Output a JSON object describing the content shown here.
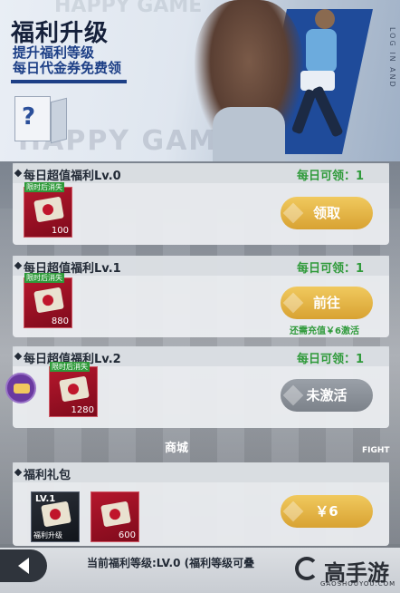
{
  "header": {
    "title": "福利升级",
    "subtitle_line1": "提升福利等级",
    "subtitle_line2": "每日代金券免费领",
    "watermark": "HAPPY GAME",
    "side_text": "LOG IN AND"
  },
  "tiers": [
    {
      "title": "每日超值福利Lv.0",
      "daily_label": "每日可领：",
      "daily_count": "1",
      "item_badge": "限时后消失",
      "item_qty": "100",
      "button_label": "领取",
      "button_state": "claimable",
      "note": ""
    },
    {
      "title": "每日超值福利Lv.1",
      "daily_label": "每日可领：",
      "daily_count": "1",
      "item_badge": "限时后消失",
      "item_qty": "880",
      "button_label": "前往",
      "button_state": "go",
      "note": "还需充值￥6激活"
    },
    {
      "title": "每日超值福利Lv.2",
      "daily_label": "每日可领：",
      "daily_count": "1",
      "item_badge": "限时后消失",
      "item_qty": "1280",
      "button_label": "未激活",
      "button_state": "inactive",
      "note": ""
    }
  ],
  "pack": {
    "title": "福利礼包",
    "level_badge": "LV.1",
    "level_item_label": "福利升级",
    "item_qty": "600",
    "price_label": "￥6"
  },
  "background": {
    "shop_label": "商城",
    "fight_label": "FIGHT"
  },
  "footer": {
    "status": "当前福利等级:LV.0 (福利等级可叠",
    "logo_name": "高手游",
    "logo_url": "GAOSHOUYOU.COM"
  },
  "colors": {
    "accent_green": "#2f9a3a",
    "button_gold": "#e0b040",
    "button_gray": "#8a9098",
    "title_navy": "#15203a",
    "subtitle_blue": "#1d3f86"
  },
  "icons": [
    "gift-box-icon",
    "voucher-icon",
    "chat-icon",
    "back-arrow-icon",
    "coin-icon"
  ]
}
